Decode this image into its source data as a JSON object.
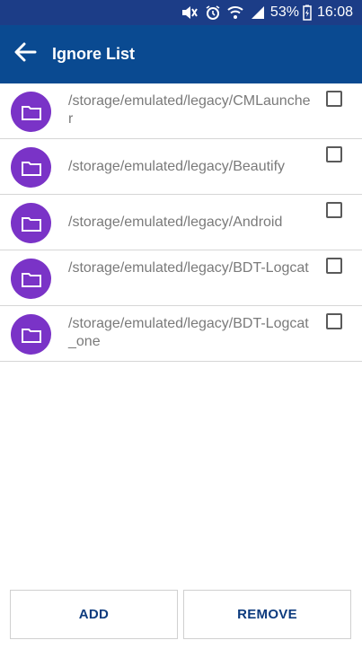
{
  "status_bar": {
    "battery_percent": "53%",
    "time": "16:08",
    "icons": [
      "mute-icon",
      "alarm-icon",
      "wifi-icon",
      "signal-icon",
      "battery-charging-icon"
    ]
  },
  "app_bar": {
    "title": "Ignore List",
    "back_icon": "arrow-left-icon"
  },
  "list": {
    "items": [
      {
        "path": "/storage/emulated/legacy/CMLauncher",
        "checked": false
      },
      {
        "path": "/storage/emulated/legacy/Beautify",
        "checked": false
      },
      {
        "path": "/storage/emulated/legacy/Android",
        "checked": false
      },
      {
        "path": "/storage/emulated/legacy/BDT-Logcat",
        "checked": false
      },
      {
        "path": "/storage/emulated/legacy/BDT-Logcat_one",
        "checked": false
      }
    ]
  },
  "actions": {
    "add_label": "ADD",
    "remove_label": "REMOVE"
  },
  "colors": {
    "status_bar": "#1c3d87",
    "app_bar": "#0a4a91",
    "folder_circle": "#7a33c7",
    "button_text": "#0d3b7e"
  }
}
